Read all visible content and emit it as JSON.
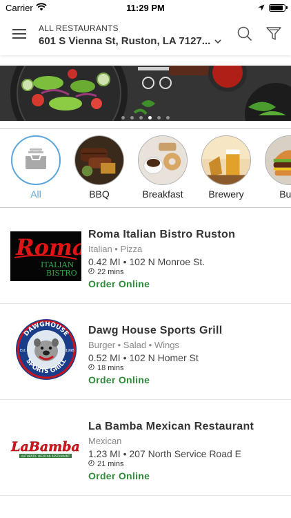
{
  "status_bar": {
    "carrier": "Carrier",
    "time": "11:29 PM",
    "battery_level": 0.9
  },
  "header": {
    "kicker": "ALL RESTAURANTS",
    "address": "601 S Vienna St, Ruston, LA 7127...",
    "icons": [
      "hamburger-menu-icon",
      "chevron-down-icon",
      "search-icon",
      "filter-icon"
    ]
  },
  "banner": {
    "slide_count": 6,
    "active_slide": 3
  },
  "categories": [
    {
      "label": "All",
      "icon": "tray-icon",
      "active": true
    },
    {
      "label": "BBQ",
      "icon": "bbq-image"
    },
    {
      "label": "Breakfast",
      "icon": "breakfast-image"
    },
    {
      "label": "Brewery",
      "icon": "brewery-image"
    },
    {
      "label": "Burg",
      "icon": "burger-image"
    }
  ],
  "restaurants": [
    {
      "name": "Roma Italian Bistro Ruston",
      "cuisine": "Italian • Pizza",
      "distance": "0.42 MI • 102 N Monroe St.",
      "eta": "22 mins",
      "action": "Order Online",
      "logo": {
        "word": "Roma",
        "line1": "ITALIAN",
        "line2": "BISTRO"
      }
    },
    {
      "name": "Dawg House Sports Grill",
      "cuisine": "Burger • Salad • Wings",
      "distance": "0.52 MI • 102 N Homer St",
      "eta": "18 mins",
      "action": "Order Online",
      "logo": {
        "top": "DAWGHOUSE",
        "bottom": "SPORTS GRILL",
        "left": "Est.",
        "right": "1998"
      }
    },
    {
      "name": "La Bamba Mexican Restaurant",
      "cuisine": "Mexican",
      "distance": "1.23 MI • 207 North Service Road E",
      "eta": "21 mins",
      "action": "Order Online",
      "logo": {
        "word": "LaBamba",
        "tag": "AUTHENTIC MEXICAN RESTAURANT"
      }
    }
  ],
  "colors": {
    "accent": "#5aa6dc",
    "order_green": "#2e8b3a",
    "muted_text": "#8a8a8a"
  }
}
